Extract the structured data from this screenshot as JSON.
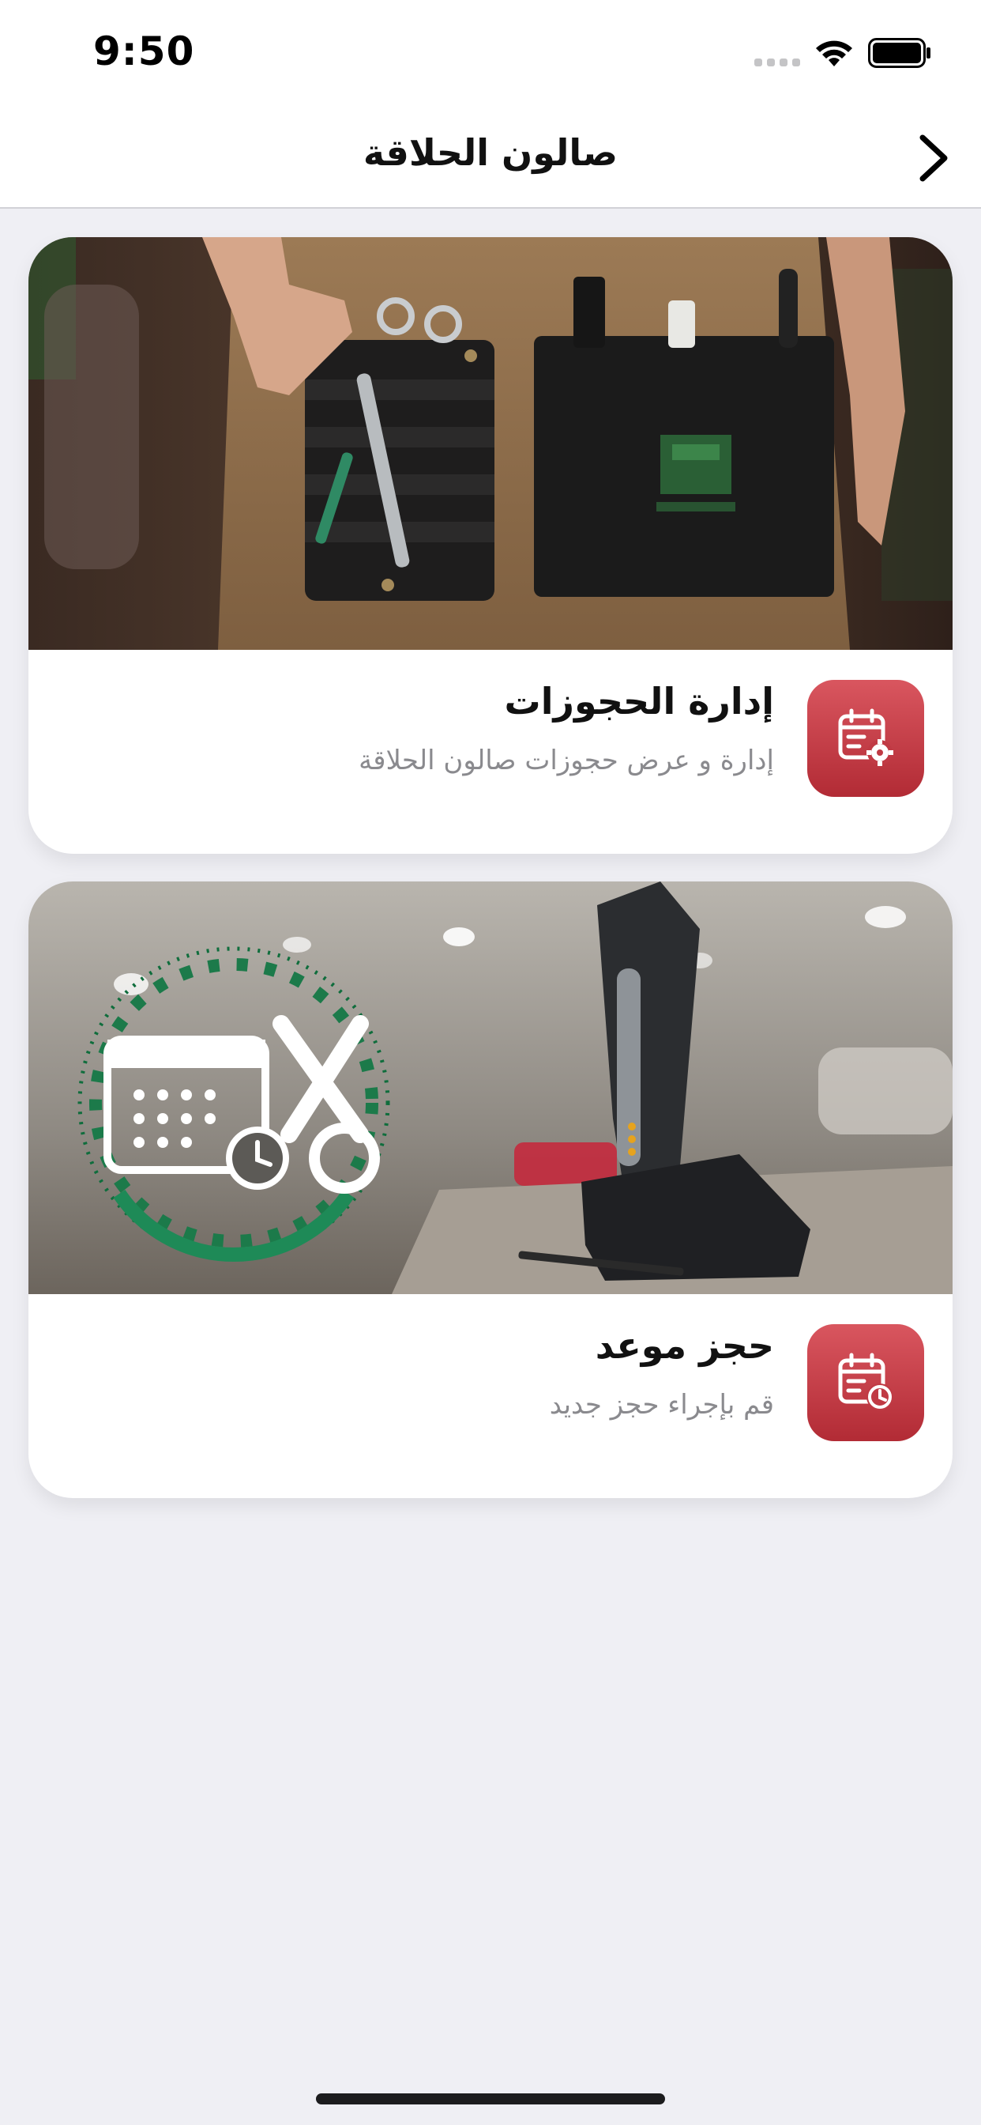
{
  "status_bar": {
    "time": "9:50",
    "icons": [
      "signal-icon",
      "wifi-icon",
      "battery-icon"
    ]
  },
  "nav": {
    "title": "صالون الحلاقة",
    "back_icon": "chevron-right-icon"
  },
  "cards": [
    {
      "title": "إدارة الحجوزات",
      "subtitle": "إدارة و عرض حجوزات صالون الحلاقة",
      "icon": "calendar-settings-icon",
      "image": "barber-apron-photo"
    },
    {
      "title": "حجز موعد",
      "subtitle": "قم بإجراء حجز جديد",
      "icon": "calendar-clock-icon",
      "image": "hair-clipper-photo"
    }
  ],
  "colors": {
    "background": "#efeff4",
    "accent_red": "#c43c46",
    "logo_green": "#1e8a57"
  }
}
